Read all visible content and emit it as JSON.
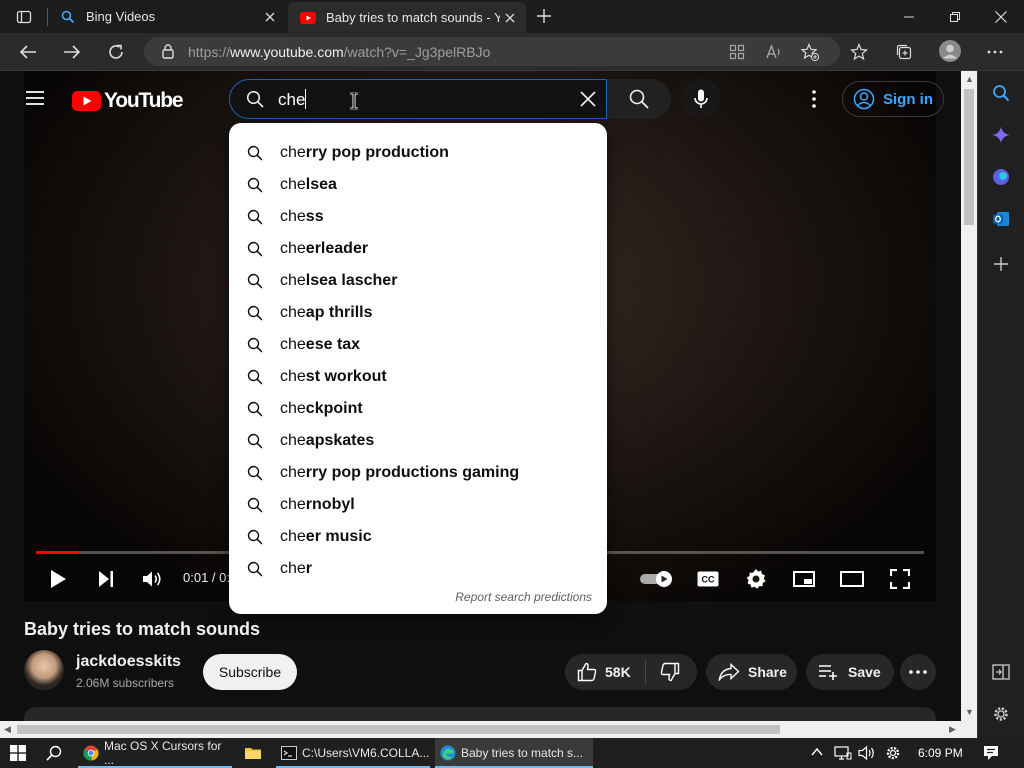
{
  "browser": {
    "tabs": [
      {
        "title": "Bing Videos"
      },
      {
        "title": "Baby tries to match sounds - YouTube"
      }
    ],
    "url_prefix": "https://",
    "url_host": "www.youtube.com",
    "url_path": "/watch?v=_Jg3pelRBJo"
  },
  "youtube": {
    "logo_text": "YouTube",
    "search_value": "che",
    "signin_label": "Sign in",
    "suggestions": [
      {
        "bold": "rry pop production"
      },
      {
        "bold": "lsea"
      },
      {
        "bold": "ss"
      },
      {
        "bold": "erleader"
      },
      {
        "bold": "lsea lascher"
      },
      {
        "bold": "ap thrills"
      },
      {
        "bold": "ese tax"
      },
      {
        "bold": "st workout"
      },
      {
        "bold": "ckpoint"
      },
      {
        "bold": "apskates"
      },
      {
        "bold": "rry pop productions gaming"
      },
      {
        "bold": "rnobyl"
      },
      {
        "bold": "er music"
      },
      {
        "bold": "r"
      }
    ],
    "report_label": "Report search predictions",
    "player": {
      "time_display": "0:01 / 0:",
      "played_fraction": 0.05
    },
    "video_title": "Baby tries to match sounds",
    "channel_name": "jackdoesskits",
    "subscribers": "2.06M subscribers",
    "subscribe_label": "Subscribe",
    "like_count": "58K",
    "share_label": "Share",
    "save_label": "Save"
  },
  "taskbar": {
    "apps": [
      {
        "label": "Mac OS X Cursors for ..."
      },
      {
        "label": "C:\\Users\\VM6.COLLA..."
      },
      {
        "label": "Baby tries to match s..."
      }
    ],
    "time": "6:09 PM"
  },
  "colors": {
    "youtube_red": "#ff0000",
    "link_blue": "#3ea6ff",
    "taskbar_accent": "#76b9ed"
  }
}
